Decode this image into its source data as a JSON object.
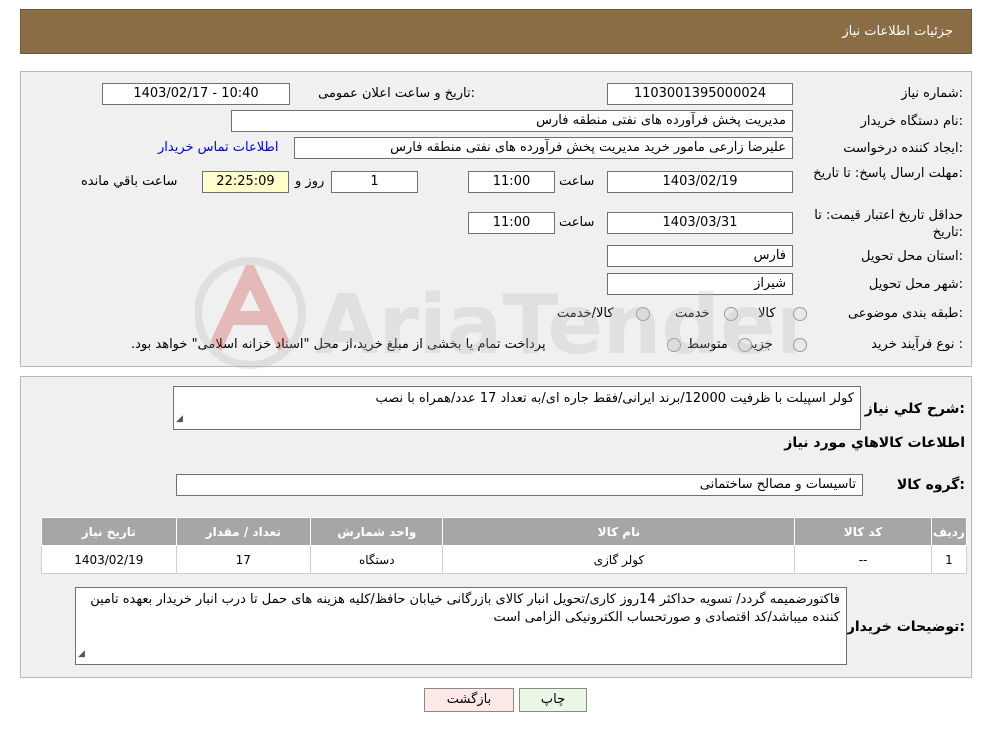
{
  "header": {
    "title": "جزئیات اطلاعات نیاز"
  },
  "need_number": {
    "label": "شماره نیاز:",
    "value": "1103001395000024"
  },
  "announce": {
    "label": "تاریخ و ساعت اعلان عمومی:",
    "value": "1403/02/17 - 10:40"
  },
  "buyer_org": {
    "label": "نام دستگاه خریدار:",
    "value": "مدیریت پخش فرآورده های نفتی منطقه فارس"
  },
  "requester": {
    "label": "ایجاد کننده درخواست:",
    "value": "علیرضا زارعی مامور خرید مدیریت پخش فرآورده های نفتی منطقه فارس",
    "contact_link": "اطلاعات تماس خریدار"
  },
  "deadline": {
    "label": "مهلت ارسال پاسخ: تا تاریخ:",
    "date": "1403/02/19",
    "time_label": "ساعت",
    "time": "11:00",
    "days": "1",
    "days_label": "روز و",
    "remaining": "22:25:09",
    "remaining_label": "ساعت باقي مانده"
  },
  "validity": {
    "label": "حداقل تاریخ اعتبار قیمت: تا تاریخ:",
    "date": "1403/03/31",
    "time_label": "ساعت",
    "time": "11:00"
  },
  "province": {
    "label": "استان محل تحویل:",
    "value": "فارس"
  },
  "city": {
    "label": "شهر محل تحویل:",
    "value": "شیراز"
  },
  "category": {
    "label": "طبقه بندی موضوعی:",
    "options": [
      "کالا",
      "خدمت",
      "کالا/خدمت"
    ]
  },
  "process": {
    "label": "نوع فرآیند خرید :",
    "options": [
      "جزیي",
      "متوسط"
    ],
    "note": "پرداخت تمام یا بخشی از مبلغ خرید،از محل \"اسناد خزانه اسلامی\" خواهد بود."
  },
  "description": {
    "label": "شرح کلي نیاز:",
    "value": "کولر اسپیلت با ظرفیت 12000/برند ایرانی/فقط جاره ای/به تعداد 17 عدد/همراه با نصب"
  },
  "goods_section": {
    "title": "اطلاعات کالاهاي مورد نیاز"
  },
  "goods_group": {
    "label": "گروه کالا:",
    "value": "تاسیسات و مصالح ساختمانی"
  },
  "table": {
    "headers": [
      "ردیف",
      "کد کالا",
      "نام کالا",
      "واحد شمارش",
      "تعداد / مقدار",
      "تاریخ نیاز"
    ],
    "rows": [
      [
        "1",
        "--",
        "کولر گازی",
        "دستگاه",
        "17",
        "1403/02/19"
      ]
    ]
  },
  "buyer_notes": {
    "label": "توضیحات خریدار:",
    "value": "فاکتورضمیمه گردد/ تسویه حداکثر 14روز کاری/تحویل انبار کالای بازرگانی خیابان حافظ/کلیه هزینه های حمل تا درب انبار خریدار بعهده تامین کننده میباشد/کد اقتصادی و صورتحساب الکترونیکی الزامی است"
  },
  "buttons": {
    "print": "چاپ",
    "back": "بازگشت"
  },
  "watermark": {
    "text": "AriaTender.neT"
  },
  "colors": {
    "header_bg": "#8b6d45",
    "panel_bg": "#f0f0f0",
    "link": "#0000ee",
    "table_header": "#a6a6a6",
    "back_button": "#fde8e8",
    "print_button": "#eaf7e4"
  }
}
